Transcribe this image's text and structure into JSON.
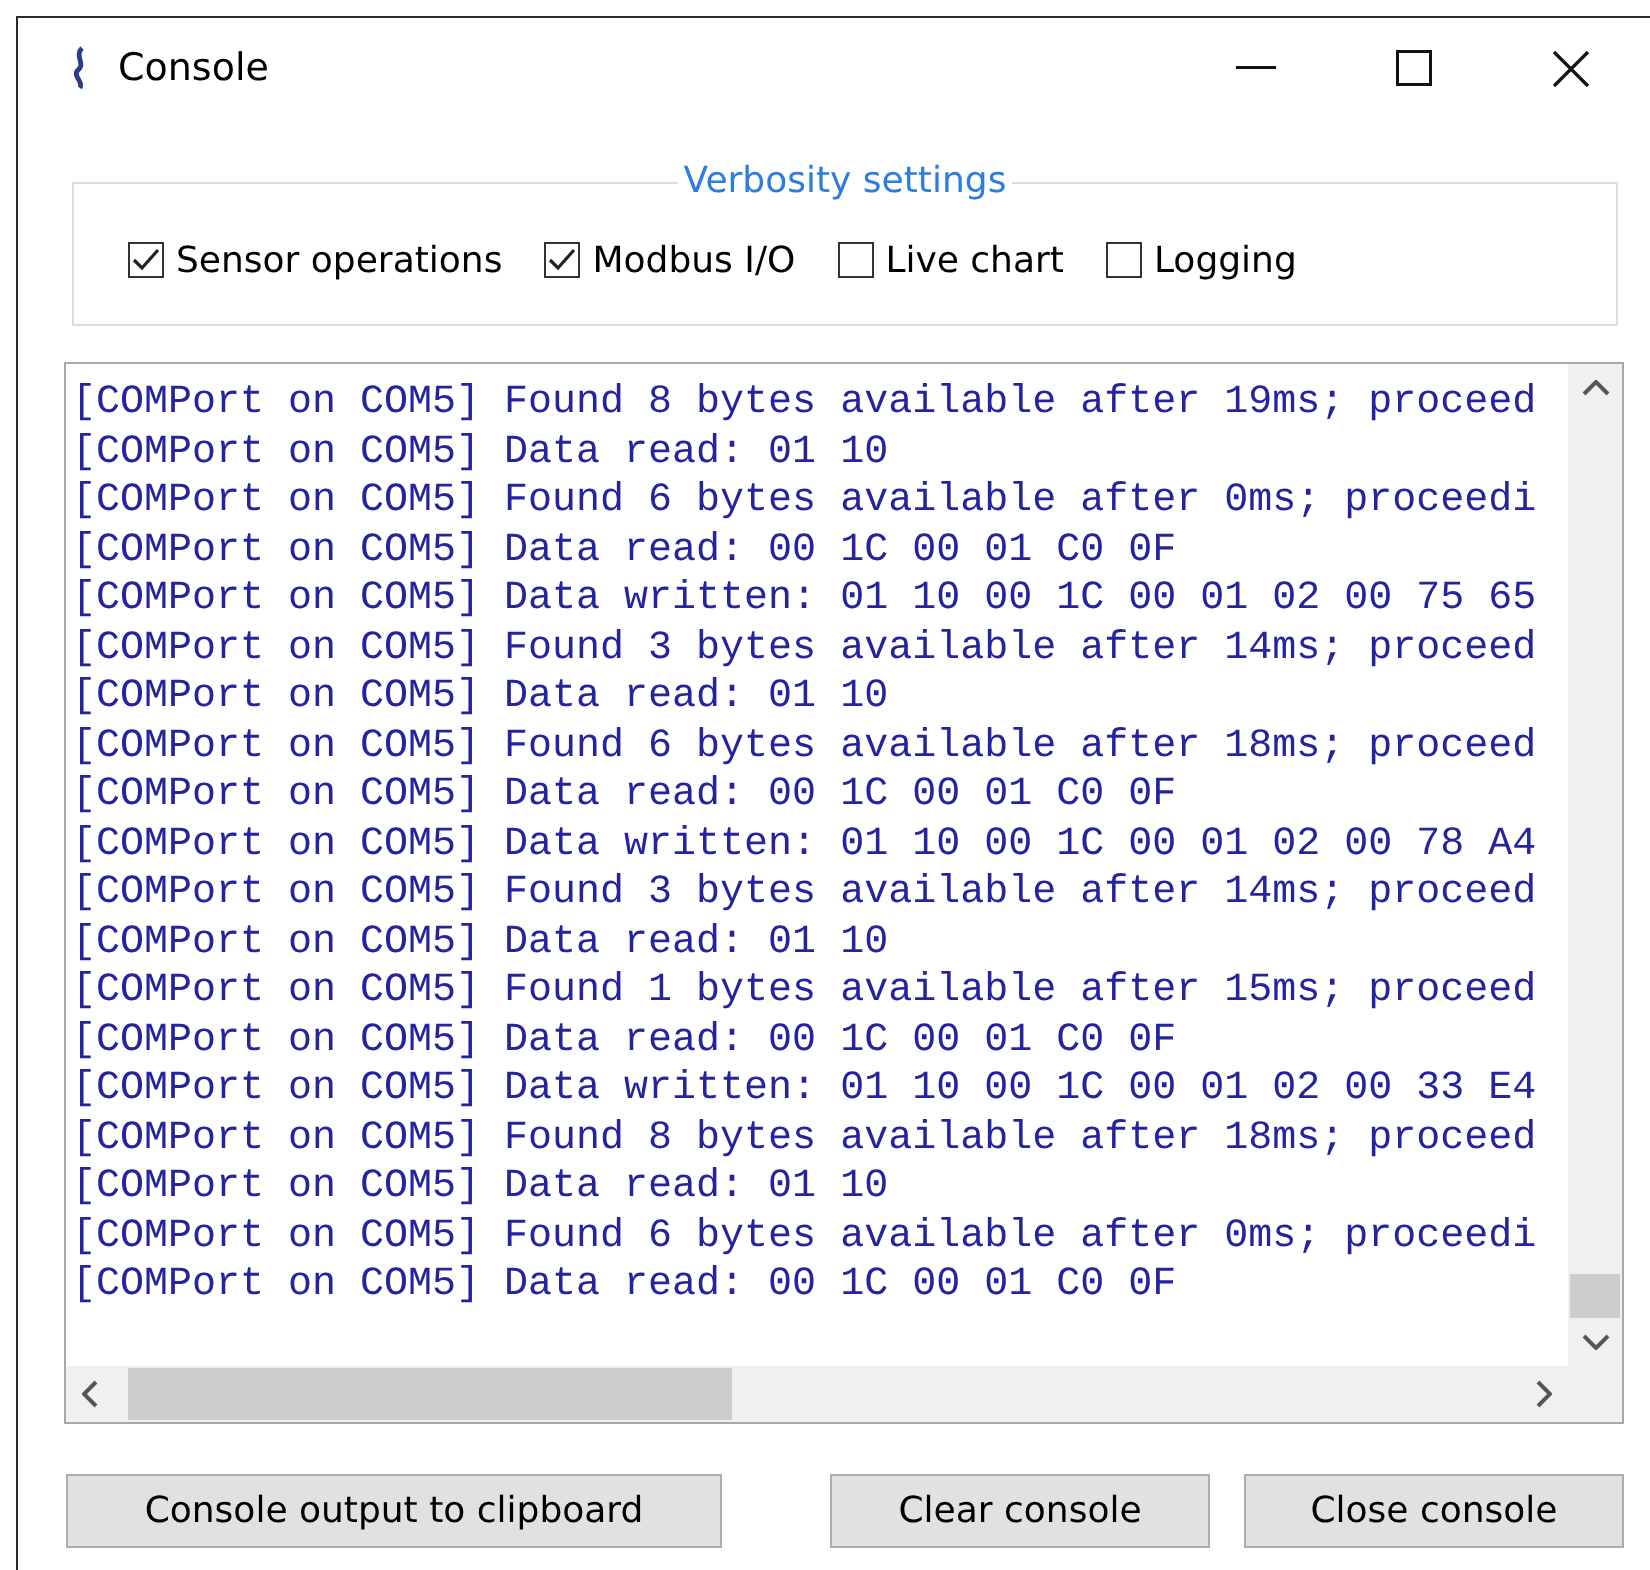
{
  "window": {
    "title": "Console"
  },
  "verbosity": {
    "title": "Verbosity settings",
    "options": [
      {
        "label": "Sensor operations",
        "checked": true
      },
      {
        "label": "Modbus I/O",
        "checked": true
      },
      {
        "label": "Live chart",
        "checked": false
      },
      {
        "label": "Logging",
        "checked": false
      }
    ]
  },
  "console_lines": [
    "[COMPort on COM5] Found 8 bytes available after 19ms; proceed",
    "[COMPort on COM5] Data read: 01 10",
    "[COMPort on COM5] Found 6 bytes available after 0ms; proceedi",
    "[COMPort on COM5] Data read: 00 1C 00 01 C0 0F",
    "[COMPort on COM5] Data written: 01 10 00 1C 00 01 02 00 75 65",
    "[COMPort on COM5] Found 3 bytes available after 14ms; proceed",
    "[COMPort on COM5] Data read: 01 10",
    "[COMPort on COM5] Found 6 bytes available after 18ms; proceed",
    "[COMPort on COM5] Data read: 00 1C 00 01 C0 0F",
    "[COMPort on COM5] Data written: 01 10 00 1C 00 01 02 00 78 A4",
    "[COMPort on COM5] Found 3 bytes available after 14ms; proceed",
    "[COMPort on COM5] Data read: 01 10",
    "[COMPort on COM5] Found 1 bytes available after 15ms; proceed",
    "[COMPort on COM5] Data read: 00 1C 00 01 C0 0F",
    "[COMPort on COM5] Data written: 01 10 00 1C 00 01 02 00 33 E4",
    "[COMPort on COM5] Found 8 bytes available after 18ms; proceed",
    "[COMPort on COM5] Data read: 01 10",
    "[COMPort on COM5] Found 6 bytes available after 0ms; proceedi",
    "[COMPort on COM5] Data read: 00 1C 00 01 C0 0F"
  ],
  "buttons": [
    "Console output to clipboard",
    "Clear console",
    "Close console"
  ]
}
